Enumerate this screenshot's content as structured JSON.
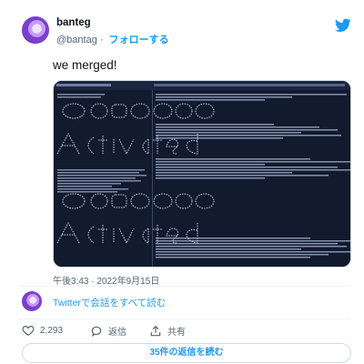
{
  "user": {
    "name": "banteg",
    "handle": "@bantag",
    "separator": "·",
    "follow_label": "フォローする"
  },
  "tweet": {
    "text": "we merged!",
    "timestamp": "午後3:43 · 2022年9月15日"
  },
  "thread_link": "Twitterで会話をすべて読む",
  "actions": {
    "like_count": "2,293",
    "reply_label": "返信",
    "share_label": "共有"
  },
  "more_replies_label": "35件の返信を読む",
  "colors": {
    "accent": "#1d9bf0",
    "muted": "#536471",
    "terminal_bg": "#121a2e"
  },
  "icons": [
    "twitter-bird-icon",
    "heart-icon",
    "reply-icon",
    "share-icon"
  ]
}
